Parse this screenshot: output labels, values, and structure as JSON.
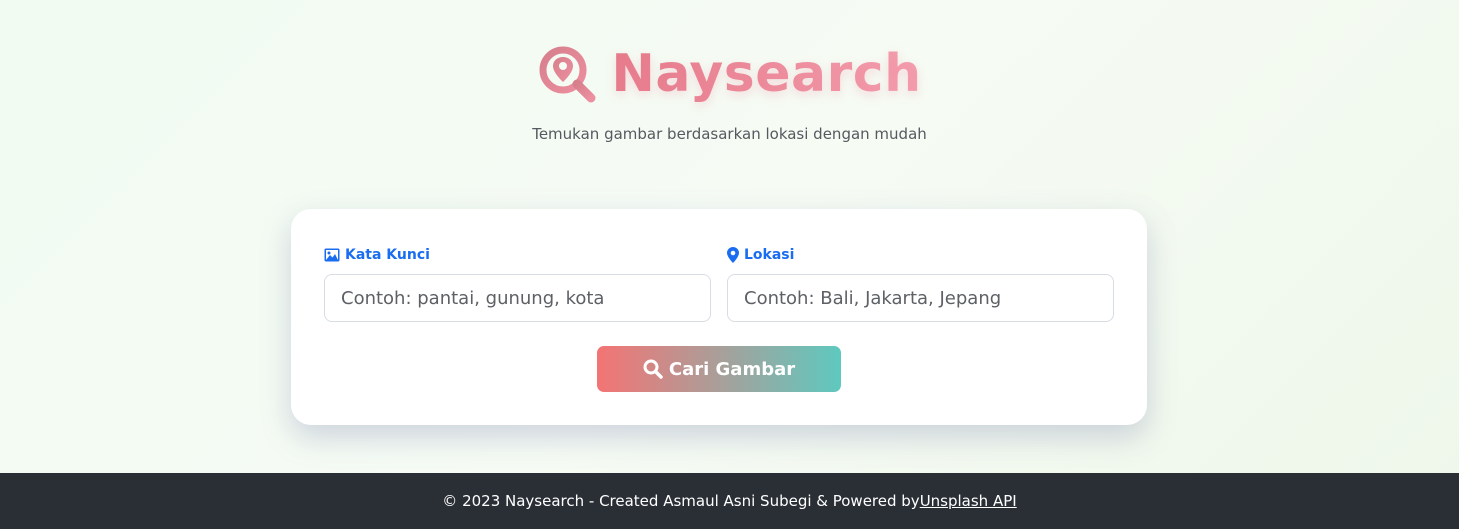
{
  "header": {
    "title": "Naysearch",
    "tagline": "Temukan gambar berdasarkan lokasi dengan mudah",
    "logo_icon": "search-location-icon"
  },
  "form": {
    "keyword": {
      "label": "Kata Kunci",
      "icon": "image-icon",
      "placeholder": "Contoh: pantai, gunung, kota",
      "value": ""
    },
    "location": {
      "label": "Lokasi",
      "icon": "map-marker-icon",
      "placeholder": "Contoh: Bali, Jakarta, Jepang",
      "value": ""
    },
    "submit": {
      "label": "Cari Gambar",
      "icon": "search-icon"
    }
  },
  "footer": {
    "text": "© 2023 Naysearch - Created Asmaul Asni Subegi & Powered by ",
    "link_text": "Unsplash API"
  },
  "colors": {
    "brand_pink": "#e57a8a",
    "label_blue": "#1a6df0",
    "button_start": "#f47474",
    "button_end": "#5ec9bf",
    "footer_bg": "#2a2f36"
  }
}
